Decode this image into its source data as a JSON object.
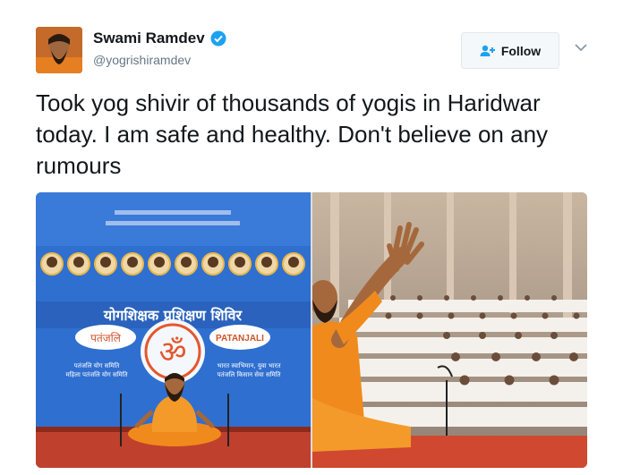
{
  "tweet": {
    "display_name": "Swami Ramdev",
    "handle": "@yogrishiramdev",
    "text": "Took yog shivir of thousands of yogis in Haridwar today. I am safe and healthy. Don't believe on any rumours"
  },
  "follow": {
    "label": "Follow"
  },
  "banner": {
    "title": "योगशिक्षक प्रशिक्षण शिविर",
    "left_logo": "पतंजलि",
    "right_logo": "PATANJALI",
    "left_line1": "पतंजलि योग समिति",
    "left_line2": "महिला पतंजलि योग समिति",
    "right_line1": "भारत स्वाभिमान, युवा भारत",
    "right_line2": "पतंजलि किसान सेवा समिति"
  },
  "colors": {
    "accent": "#1da1f2",
    "banner_blue": "#2f6fd0",
    "saffron": "#f08a1c",
    "stage_red": "#c0402e"
  },
  "icons": {
    "verified": "verified-badge-icon",
    "follow": "add-user-icon",
    "caret": "chevron-down-icon"
  }
}
